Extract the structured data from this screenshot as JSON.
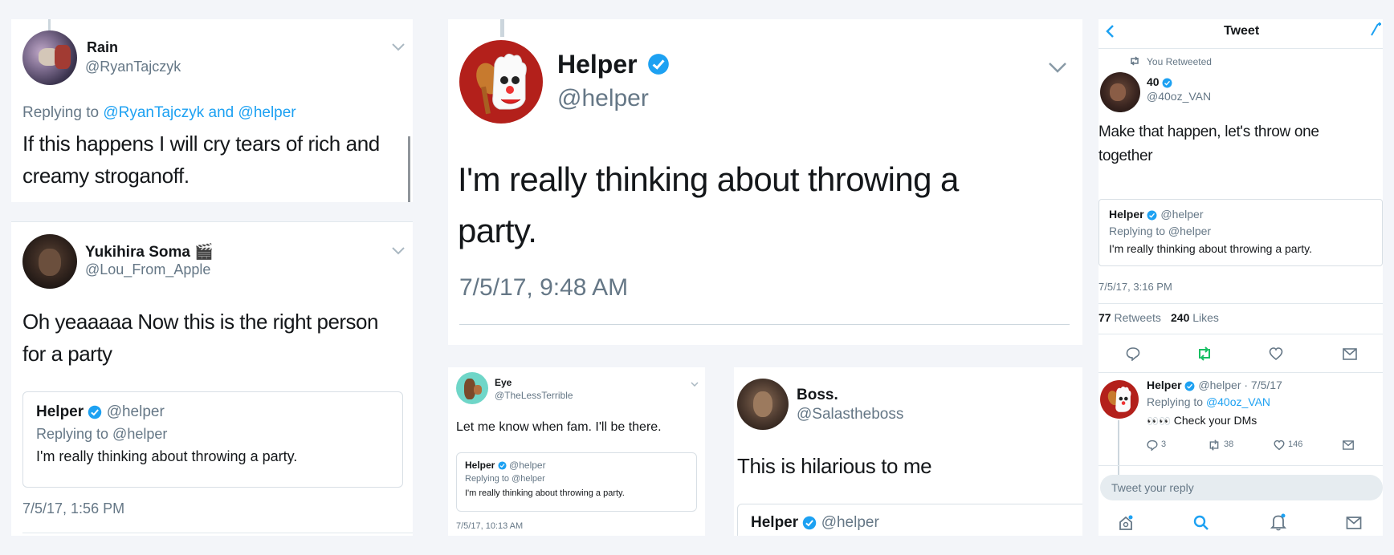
{
  "c1": {
    "name": "Rain",
    "handle": "@RyanTajczyk",
    "replying_prefix": "Replying to",
    "replying_to": "@RyanTajczyk and @helper",
    "text_l1": "If this happens I will cry tears of rich and",
    "text_l2": "creamy stroganoff."
  },
  "c2": {
    "name": "Yukihira Soma 🎬",
    "handle": "@Lou_From_Apple",
    "text_l1": "Oh yeaaaaa Now this is the right person",
    "text_l2": "for a party",
    "quote": {
      "name": "Helper",
      "handle": "@helper",
      "replying": "Replying to @helper",
      "text": "I'm really thinking about throwing a party."
    },
    "timestamp": "7/5/17, 1:56 PM"
  },
  "c3": {
    "name": "Helper",
    "handle": "@helper",
    "text_l1": "I'm really thinking about throwing a",
    "text_l2": "party.",
    "timestamp": "7/5/17, 9:48 AM"
  },
  "c4": {
    "name": "Eye",
    "handle": "@TheLessTerrible",
    "text": "Let me know when fam. I'll be there.",
    "quote": {
      "name": "Helper",
      "handle": "@helper",
      "replying": "Replying to @helper",
      "text": "I'm really thinking about throwing a party."
    },
    "timestamp": "7/5/17, 10:13 AM"
  },
  "c5": {
    "name": "Boss.",
    "handle": "@Salastheboss",
    "text": "This is hilarious to me",
    "quote_name": "Helper",
    "quote_handle": "@helper"
  },
  "c6": {
    "header_title": "Tweet",
    "retweeted_label": "You Retweeted",
    "name": "40",
    "handle": "@40oz_VAN",
    "text_l1": "Make that happen, let's throw one",
    "text_l2": "together",
    "quote": {
      "name": "Helper",
      "handle": "@helper",
      "replying": "Replying to @helper",
      "text": "I'm really thinking about throwing a party."
    },
    "timestamp": "7/5/17, 3:16 PM",
    "retweets_count": "77",
    "retweets_label": "Retweets",
    "likes_count": "240",
    "likes_label": "Likes",
    "reply": {
      "name": "Helper",
      "handle_date": "@helper · 7/5/17",
      "replying_prefix": "Replying to",
      "replying_to": "@40oz_VAN",
      "text": "Check your DMs",
      "reply_count": "3",
      "retweet_count": "38",
      "like_count": "146"
    },
    "reply_placeholder": "Tweet your reply"
  },
  "colors": {
    "accent": "#1da1f2",
    "retweet_green": "#17bf63",
    "verified": "#1da1f2",
    "text_dark": "#14171a",
    "text_grey": "#657786"
  },
  "icons": [
    "chevron-down-icon",
    "verified-icon",
    "back-arrow-icon",
    "compose-icon",
    "retweet-icon",
    "reply-icon",
    "like-icon",
    "message-icon",
    "home-icon",
    "search-icon",
    "notifications-icon"
  ]
}
